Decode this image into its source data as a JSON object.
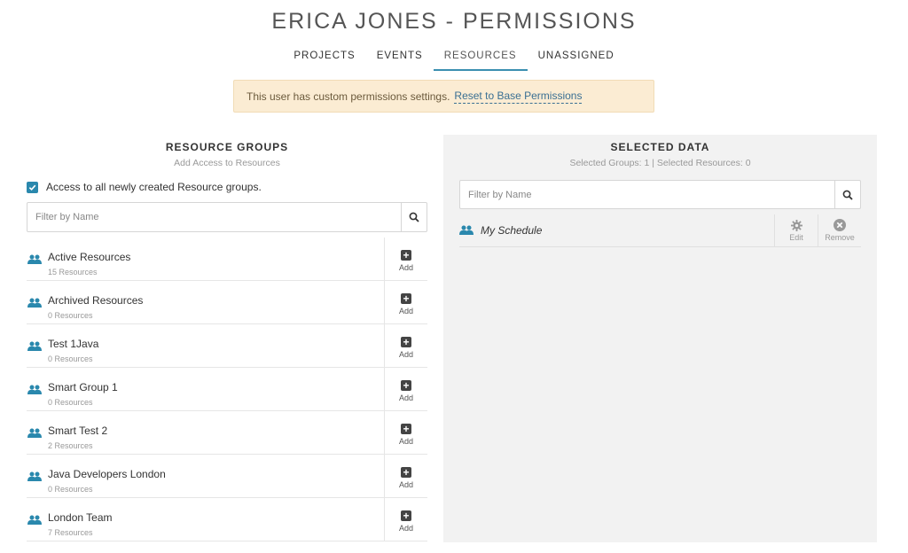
{
  "page_title": "ERICA JONES - PERMISSIONS",
  "tabs": [
    {
      "label": "PROJECTS",
      "active": false
    },
    {
      "label": "EVENTS",
      "active": false
    },
    {
      "label": "RESOURCES",
      "active": true
    },
    {
      "label": "UNASSIGNED",
      "active": false
    }
  ],
  "notice": {
    "text": "This user has custom permissions settings.",
    "link": "Reset to Base Permissions"
  },
  "resource_groups": {
    "title": "RESOURCE GROUPS",
    "subtitle": "Add Access to Resources",
    "checkbox_label": "Access to all newly created Resource groups.",
    "checkbox_checked": true,
    "search_placeholder": "Filter by Name",
    "add_label": "Add",
    "items": [
      {
        "name": "Active Resources",
        "count": "15 Resources"
      },
      {
        "name": "Archived Resources",
        "count": "0 Resources"
      },
      {
        "name": "Test 1Java",
        "count": "0 Resources"
      },
      {
        "name": "Smart Group 1",
        "count": "0 Resources"
      },
      {
        "name": "Smart Test 2",
        "count": "2 Resources"
      },
      {
        "name": "Java Developers London",
        "count": "0 Resources"
      },
      {
        "name": "London Team",
        "count": "7 Resources"
      }
    ]
  },
  "selected_data": {
    "title": "SELECTED DATA",
    "summary": "Selected Groups: 1 | Selected Resources: 0",
    "search_placeholder": "Filter by Name",
    "items": [
      {
        "name": "My Schedule",
        "edit_label": "Edit",
        "remove_label": "Remove"
      }
    ]
  },
  "colors": {
    "accent": "#2a88ad",
    "notice_bg": "#fbecd3",
    "link": "#3a6f93",
    "panel_bg": "#f2f2f2"
  },
  "icons": {
    "group": "group-icon",
    "search": "search-icon",
    "add": "plus-square-icon",
    "edit": "gear-icon",
    "remove": "close-circle-icon",
    "checkbox": "check-icon"
  }
}
